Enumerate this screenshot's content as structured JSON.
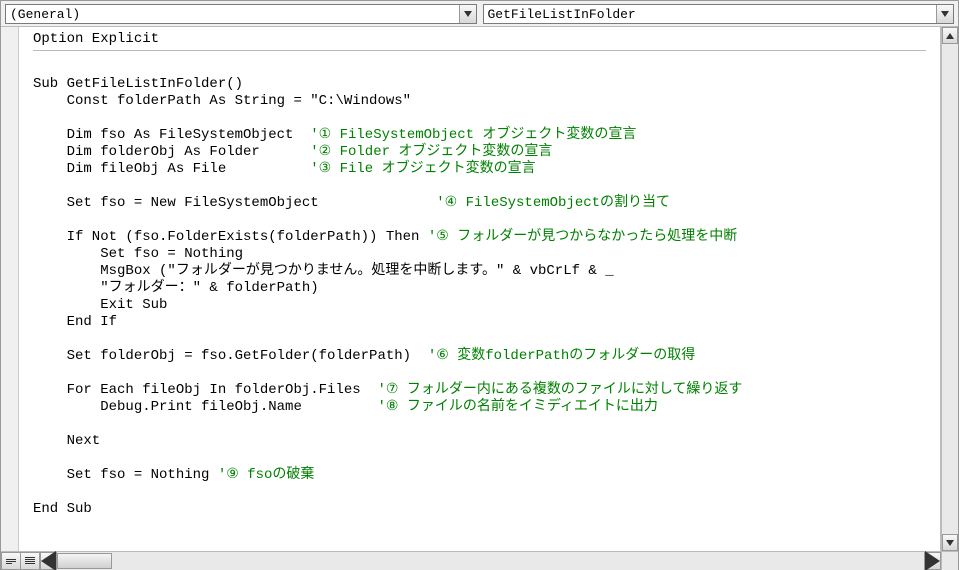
{
  "toolbar": {
    "scope_selector": "(General)",
    "proc_selector": "GetFileListInFolder"
  },
  "code": {
    "l01": "Option Explicit",
    "l02": "",
    "l03": "Sub GetFileListInFolder()",
    "l04": "    Const folderPath As String = \"C:\\Windows\"",
    "l05": "",
    "l06_a": "    Dim fso As FileSystemObject  ",
    "l06_c": "'① FileSystemObject オブジェクト変数の宣言",
    "l07_a": "    Dim folderObj As Folder      ",
    "l07_c": "'② Folder オブジェクト変数の宣言",
    "l08_a": "    Dim fileObj As File          ",
    "l08_c": "'③ File オブジェクト変数の宣言",
    "l09": "",
    "l10_a": "    Set fso = New FileSystemObject              ",
    "l10_c": "'④ FileSystemObjectの割り当て",
    "l11": "",
    "l12_a": "    If Not (fso.FolderExists(folderPath)) Then ",
    "l12_c": "'⑤ フォルダーが見つからなかったら処理を中断",
    "l13": "        Set fso = Nothing",
    "l14": "        MsgBox (\"フォルダーが見つかりません。処理を中断します。\" & vbCrLf & _",
    "l15": "        \"フォルダー：\" & folderPath)",
    "l16": "        Exit Sub",
    "l17": "    End If",
    "l18": "",
    "l19_a": "    Set folderObj = fso.GetFolder(folderPath)  ",
    "l19_c": "'⑥ 変数folderPathのフォルダーの取得",
    "l20": "",
    "l21_a": "    For Each fileObj In folderObj.Files  ",
    "l21_c": "'⑦ フォルダー内にある複数のファイルに対して繰り返す",
    "l22_a": "        Debug.Print fileObj.Name         ",
    "l22_c": "'⑧ ファイルの名前をイミディエイトに出力",
    "l23": "",
    "l24": "    Next",
    "l25": "",
    "l26_a": "    Set fso = Nothing ",
    "l26_c": "'⑨ fsoの破棄",
    "l27": "",
    "l28": "End Sub"
  }
}
